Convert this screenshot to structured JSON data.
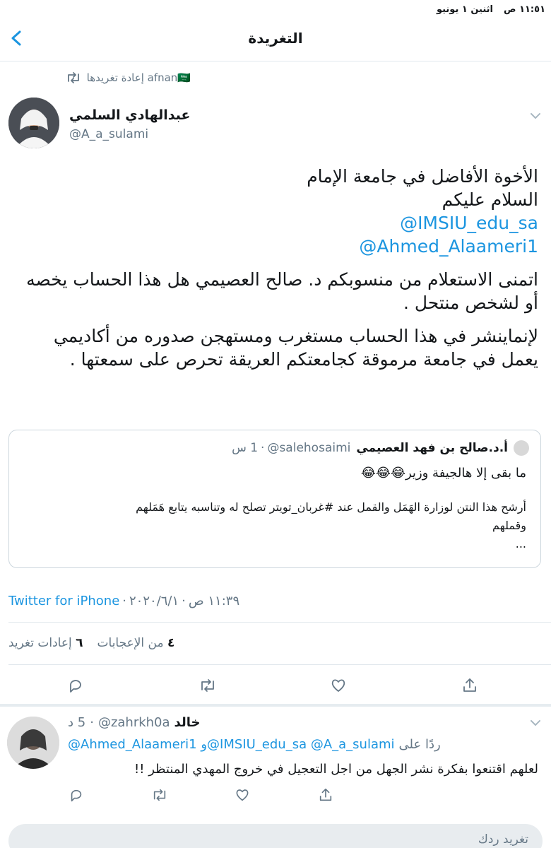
{
  "status_bar": {
    "time": "١١:٥١ ص",
    "date": "اثنين ١ يونيو"
  },
  "header": {
    "title": "التغريدة"
  },
  "retweet_banner": {
    "text": "afnan🇸🇦 إعادة تغريدها"
  },
  "tweet": {
    "author_name": "عبدالهادي السلمي",
    "author_handle": "@A_a_sulami",
    "body": {
      "line1": "الأخوة الأفاضل في جامعة الإمام",
      "line2": "السلام عليكم",
      "mention1": "@IMSIU_edu_sa",
      "mention2": "@Ahmed_Alaameri1",
      "para1_line1": "اتمنى الاستعلام من منسوبكم د. صالح العصيمي هل هذا الحساب يخصه",
      "para1_line2": "أو لشخص منتحل .",
      "para2_line1": "لإنماينشر في هذا الحساب مستغرب ومستهجن صدوره من أكاديمي",
      "para2_line2": "يعمل في جامعة مرموقة كجامعتكم العريقة تحرص على سمعتها ."
    },
    "meta": {
      "time": "١١:٣٩ ص",
      "date": "٢٠٢٠/٦/١",
      "source": "Twitter for iPhone"
    },
    "stats": {
      "retweets_count": "٦",
      "retweets_label": "إعادات تغريد",
      "likes_count": "٤",
      "likes_label": "من الإعجابات"
    }
  },
  "quoted": {
    "name": "أ.د.صالح بن فهد العصيمي",
    "handle": "@salehosaimi",
    "time": "1 س",
    "line1": "ما بقى إلا هالجيفة وزير😂😂😂",
    "line2": "أرشح هذا النتن لوزارة الهَمَل والقمل عند #غربان_تويتر تصلح له وتناسبه يتابع هَمَلهم",
    "line3": "وقملهم",
    "line4": "..."
  },
  "reply": {
    "name": "خالد",
    "handle": "@zahrkh0a",
    "time": "5 د",
    "replying_label": "ردًا على",
    "replying_to": "@Ahmed_Alaameri1 و@IMSIU_edu_sa @A_a_sulami",
    "text": "لعلهم اقتنعوا بفكرة نشر الجهل من اجل التعجيل في خروج المهدي المنتظر !!"
  },
  "compose": {
    "placeholder": "تغريد ردك"
  },
  "icons": {
    "back": "chevron-left-icon",
    "retweet": "retweet-icon",
    "reply": "reply-icon",
    "like": "heart-icon",
    "share": "share-icon",
    "more": "chevron-down-icon"
  },
  "colors": {
    "link": "#1b95e0",
    "secondary": "#657786",
    "divider": "#e1e8ed"
  }
}
